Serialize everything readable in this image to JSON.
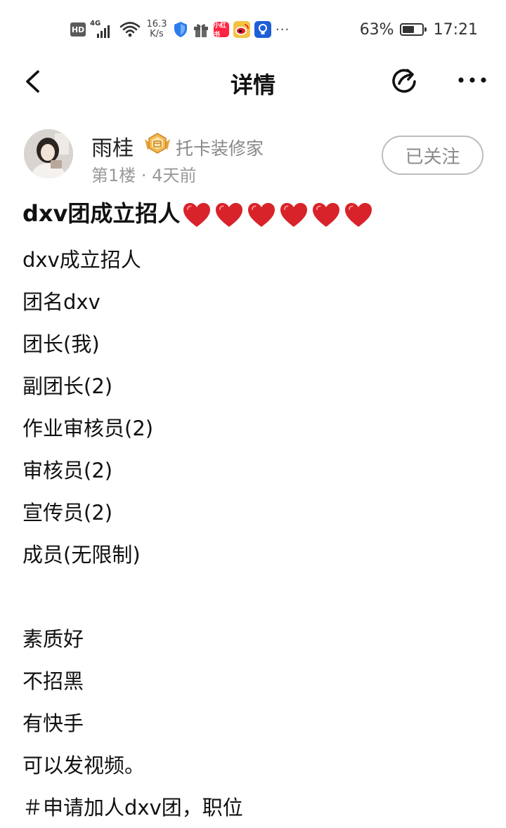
{
  "status_bar": {
    "hd": "HD",
    "network": "4G",
    "speed_value": "16.3",
    "speed_unit": "K/s",
    "app_icons": [
      "shield-icon",
      "gift-icon",
      "xiaohongshu-icon",
      "weibo-icon",
      "lightbulb-icon"
    ],
    "xiaohongshu_text": "小红书",
    "more": "···",
    "battery_percent": "63%",
    "battery_level": 0.63,
    "time": "17:21"
  },
  "nav": {
    "title": "详情",
    "icons": [
      "back-chevron-icon",
      "share-icon",
      "more-dots-icon"
    ]
  },
  "author": {
    "name": "雨桂",
    "title": "托卡装修家",
    "floor": "第1楼",
    "separator": "·",
    "time_ago": "4天前",
    "follow_label": "已关注",
    "badge_color": "#E8A53A"
  },
  "post": {
    "title": "dxv团成立招人",
    "heart_count": 6,
    "heart_color": "#D8232A",
    "lines": [
      "dxv成立招人",
      "团名dxv",
      "团长(我)",
      "副团长(2)",
      "作业审核员(2)",
      "审核员(2)",
      "宣传员(2)",
      "成员(无限制)",
      "",
      "素质好",
      "不招黑",
      "有快手",
      "可以发视频。",
      "＃申请加人dxv团，职位"
    ]
  }
}
